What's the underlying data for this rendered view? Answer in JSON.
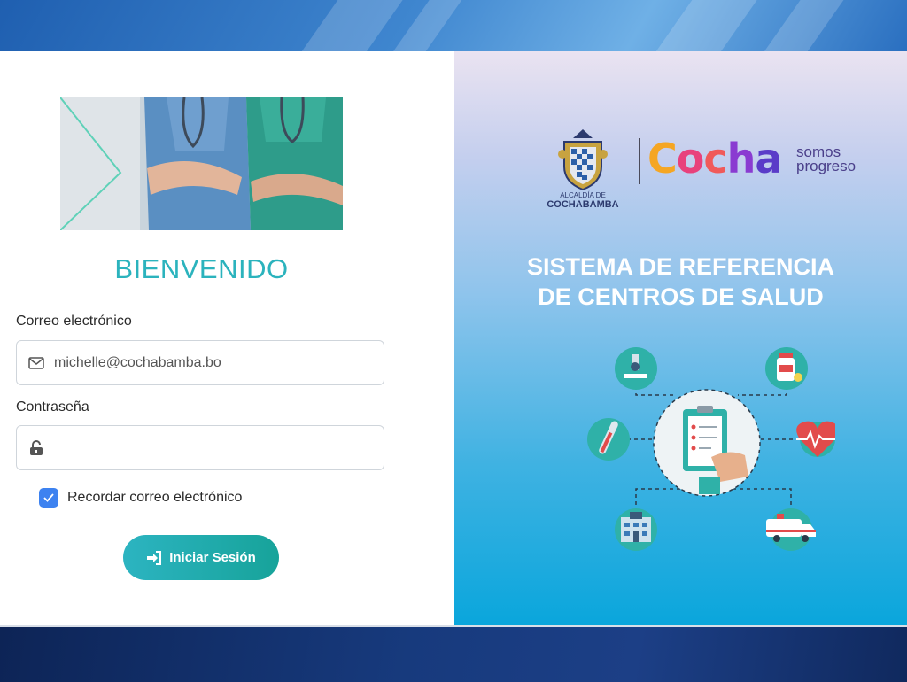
{
  "login": {
    "welcome": "BIENVENIDO",
    "email_label": "Correo electrónico",
    "email_value": "michelle@cochabamba.bo",
    "password_label": "Contraseña",
    "password_value": "",
    "remember_label": "Recordar correo electrónico",
    "remember_checked": true,
    "submit_label": "Iniciar Sesión"
  },
  "branding": {
    "crest_caption_line1": "ALCALDÍA DE",
    "crest_caption_line2": "COCHABAMBA",
    "logo_letters": [
      "C",
      "o",
      "c",
      "h",
      "a"
    ],
    "logo_tagline_line1": "somos",
    "logo_tagline_line2": "progreso"
  },
  "system": {
    "title_line1": "SISTEMA DE REFERENCIA",
    "title_line2": "DE CENTROS DE SALUD"
  },
  "icons": {
    "email": "envelope-icon",
    "password": "unlock-icon",
    "checkbox": "check-icon",
    "submit": "sign-in-icon",
    "illustration": [
      "microscope-icon",
      "medicine-bottle-icon",
      "thermometer-icon",
      "heartbeat-icon",
      "hospital-icon",
      "ambulance-icon",
      "clipboard-icon"
    ]
  },
  "colors": {
    "accent": "#2bb3bd",
    "button_start": "#2cb4c1",
    "button_end": "#17a39a",
    "checkbox": "#3d82f0"
  }
}
